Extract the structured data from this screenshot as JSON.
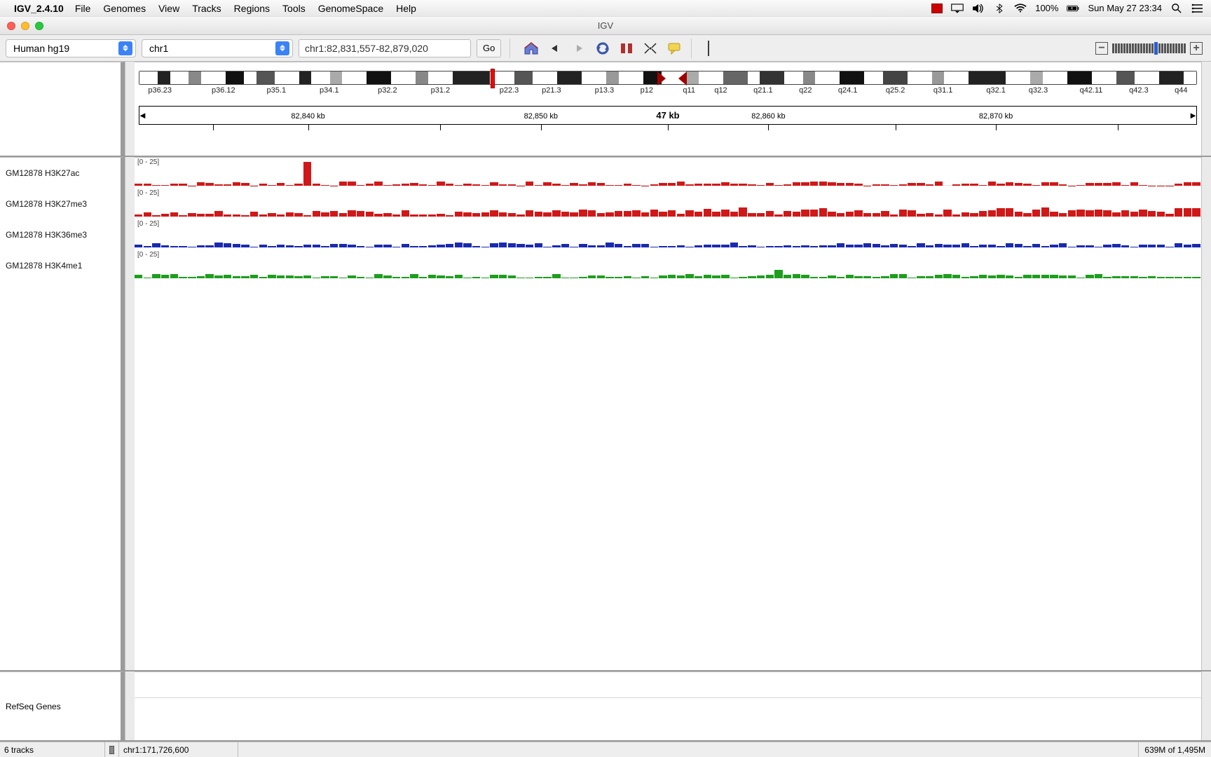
{
  "menubar": {
    "app_name": "IGV_2.4.10",
    "items": [
      "File",
      "Genomes",
      "View",
      "Tracks",
      "Regions",
      "Tools",
      "GenomeSpace",
      "Help"
    ],
    "battery_pct": "100%",
    "clock": "Sun May 27  23:34"
  },
  "window": {
    "title": "IGV"
  },
  "toolbar": {
    "genome": "Human hg19",
    "chromosome": "chr1",
    "locus": "chr1:82,831,557-82,879,020",
    "go_label": "Go"
  },
  "ideogram": {
    "bands": [
      {
        "w": 1.5,
        "c": "#fff"
      },
      {
        "w": 1,
        "c": "#222"
      },
      {
        "w": 1.5,
        "c": "#fff"
      },
      {
        "w": 1,
        "c": "#888"
      },
      {
        "w": 2,
        "c": "#fff"
      },
      {
        "w": 1.5,
        "c": "#111"
      },
      {
        "w": 1,
        "c": "#fff"
      },
      {
        "w": 1.5,
        "c": "#555"
      },
      {
        "w": 2,
        "c": "#fff"
      },
      {
        "w": 1,
        "c": "#222"
      },
      {
        "w": 1.5,
        "c": "#fff"
      },
      {
        "w": 1,
        "c": "#aaa"
      },
      {
        "w": 2,
        "c": "#fff"
      },
      {
        "w": 2,
        "c": "#111"
      },
      {
        "w": 2,
        "c": "#fff"
      },
      {
        "w": 1,
        "c": "#888"
      },
      {
        "w": 2,
        "c": "#fff"
      },
      {
        "w": 3,
        "c": "#222"
      },
      {
        "w": 2,
        "c": "#fff"
      },
      {
        "w": 1.5,
        "c": "#555"
      },
      {
        "w": 2,
        "c": "#fff"
      },
      {
        "w": 2,
        "c": "#222"
      },
      {
        "w": 2,
        "c": "#fff"
      },
      {
        "w": 1,
        "c": "#999"
      },
      {
        "w": 2,
        "c": "#fff"
      },
      {
        "w": 1.5,
        "c": "#111"
      },
      {
        "w": 2,
        "c": "#fff"
      },
      {
        "w": 1,
        "c": "#aaa"
      },
      {
        "w": 2,
        "c": "#fff"
      },
      {
        "w": 2,
        "c": "#666"
      },
      {
        "w": 1,
        "c": "#fff"
      },
      {
        "w": 2,
        "c": "#333"
      },
      {
        "w": 1.5,
        "c": "#fff"
      },
      {
        "w": 1,
        "c": "#888"
      },
      {
        "w": 2,
        "c": "#fff"
      },
      {
        "w": 2,
        "c": "#111"
      },
      {
        "w": 1.5,
        "c": "#fff"
      },
      {
        "w": 2,
        "c": "#444"
      },
      {
        "w": 2,
        "c": "#fff"
      },
      {
        "w": 1,
        "c": "#999"
      },
      {
        "w": 2,
        "c": "#fff"
      },
      {
        "w": 3,
        "c": "#222"
      },
      {
        "w": 2,
        "c": "#fff"
      },
      {
        "w": 1,
        "c": "#aaa"
      },
      {
        "w": 2,
        "c": "#fff"
      },
      {
        "w": 2,
        "c": "#111"
      },
      {
        "w": 2,
        "c": "#fff"
      },
      {
        "w": 1.5,
        "c": "#555"
      },
      {
        "w": 2,
        "c": "#fff"
      },
      {
        "w": 2,
        "c": "#222"
      },
      {
        "w": 1,
        "c": "#fff"
      }
    ],
    "marker_left_pct": 33.2,
    "cent_left_pct": 49.0,
    "cent_right_pct": 51.0,
    "labels": [
      {
        "t": "p36.23",
        "l": 2
      },
      {
        "t": "p36.12",
        "l": 8
      },
      {
        "t": "p35.1",
        "l": 13
      },
      {
        "t": "p34.1",
        "l": 18
      },
      {
        "t": "p32.2",
        "l": 23.5
      },
      {
        "t": "p31.2",
        "l": 28.5
      },
      {
        "t": "p22.3",
        "l": 35
      },
      {
        "t": "p21.3",
        "l": 39
      },
      {
        "t": "p13.3",
        "l": 44
      },
      {
        "t": "p12",
        "l": 48
      },
      {
        "t": "q11",
        "l": 52
      },
      {
        "t": "q12",
        "l": 55
      },
      {
        "t": "q21.1",
        "l": 59
      },
      {
        "t": "q22",
        "l": 63
      },
      {
        "t": "q24.1",
        "l": 67
      },
      {
        "t": "q25.2",
        "l": 71.5
      },
      {
        "t": "q31.1",
        "l": 76
      },
      {
        "t": "q32.1",
        "l": 81
      },
      {
        "t": "q32.3",
        "l": 85
      },
      {
        "t": "q42.11",
        "l": 90
      },
      {
        "t": "q42.3",
        "l": 94.5
      },
      {
        "t": "q44",
        "l": 98.5
      }
    ]
  },
  "ruler": {
    "span_label": "47 kb",
    "ticks": [
      {
        "l": 7,
        "label": ""
      },
      {
        "l": 16,
        "label": "82,840 kb"
      },
      {
        "l": 28.5,
        "label": ""
      },
      {
        "l": 38,
        "label": "82,850 kb"
      },
      {
        "l": 50,
        "label": ""
      },
      {
        "l": 59.5,
        "label": "82,860 kb"
      },
      {
        "l": 71.5,
        "label": ""
      },
      {
        "l": 81,
        "label": "82,870 kb"
      },
      {
        "l": 92.5,
        "label": ""
      }
    ]
  },
  "tracks": [
    {
      "name": "GM12878 H3K27ac",
      "range": "[0 - 25]",
      "color": "#d01818"
    },
    {
      "name": "GM12878 H3K27me3",
      "range": "[0 - 25]",
      "color": "#d01818"
    },
    {
      "name": "GM12878 H3K36me3",
      "range": "[0 - 25]",
      "color": "#1a2ab0"
    },
    {
      "name": "GM12878 H3K4me1",
      "range": "[0 - 25]",
      "color": "#1e9e1e"
    }
  ],
  "refseq": {
    "name": "RefSeq Genes"
  },
  "status": {
    "track_count": "6 tracks",
    "hover_pos": "chr1:171,726,600",
    "memory": "639M of 1,495M"
  },
  "zoom": {
    "total_ticks": 26,
    "current": 15
  }
}
